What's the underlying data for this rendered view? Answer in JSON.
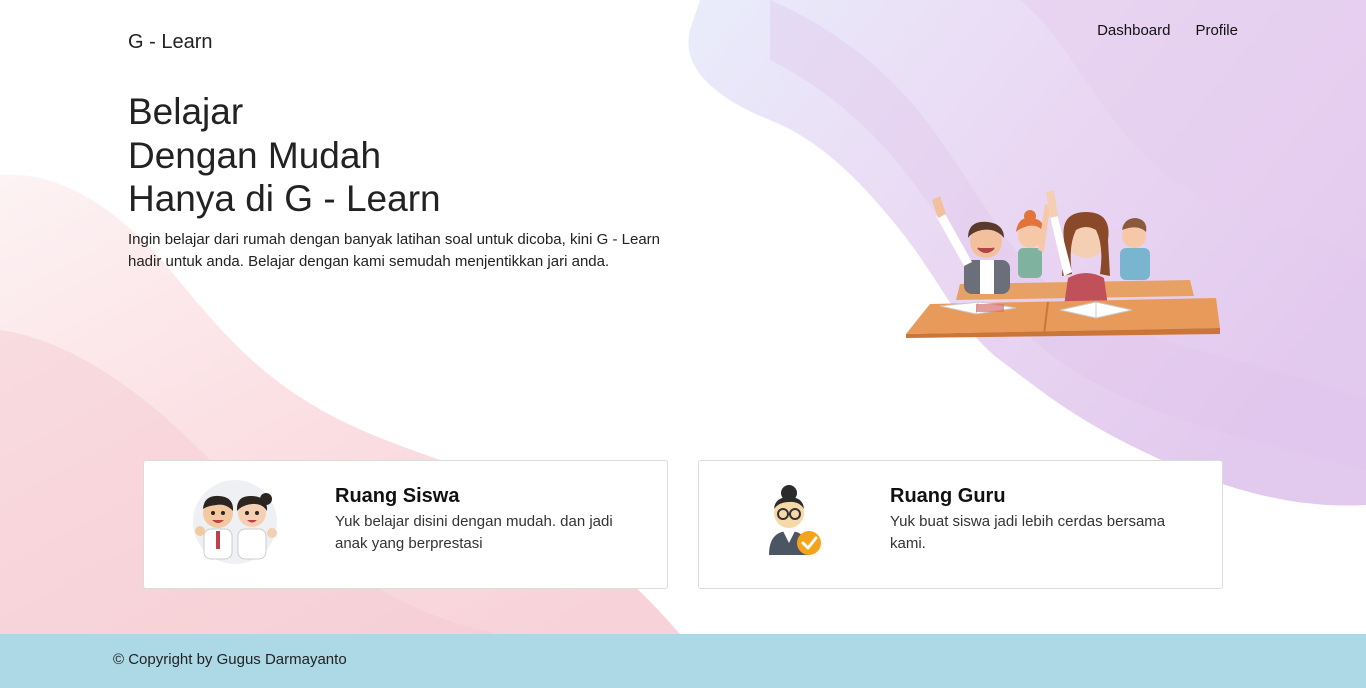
{
  "navbar": {
    "brand": "G - Learn",
    "links": [
      {
        "label": "Dashboard"
      },
      {
        "label": "Profile"
      }
    ]
  },
  "hero": {
    "title_lines": [
      "Belajar",
      "Dengan Mudah",
      "Hanya di G - Learn"
    ],
    "description": "Ingin belajar dari rumah dengan banyak latihan soal untuk dicoba, kini G - Learn hadir untuk anda. Belajar dengan kami semudah menjentikkan jari anda.",
    "illustration": "students-raising-hands-illustration"
  },
  "cards": [
    {
      "title": "Ruang Siswa",
      "description": "Yuk belajar disini dengan mudah. dan jadi anak yang berprestasi",
      "icon": "student-kids-icon"
    },
    {
      "title": "Ruang Guru",
      "description": "Yuk buat siswa jadi lebih cerdas bersama kami.",
      "icon": "teacher-check-icon"
    }
  ],
  "footer": {
    "copyright": "© Copyright by Gugus Darmayanto"
  },
  "colors": {
    "footer_bg": "#add8e6",
    "blob_purple": "#e6d4f2",
    "blob_pink": "#f9d9de",
    "check_orange": "#f5a31a"
  }
}
